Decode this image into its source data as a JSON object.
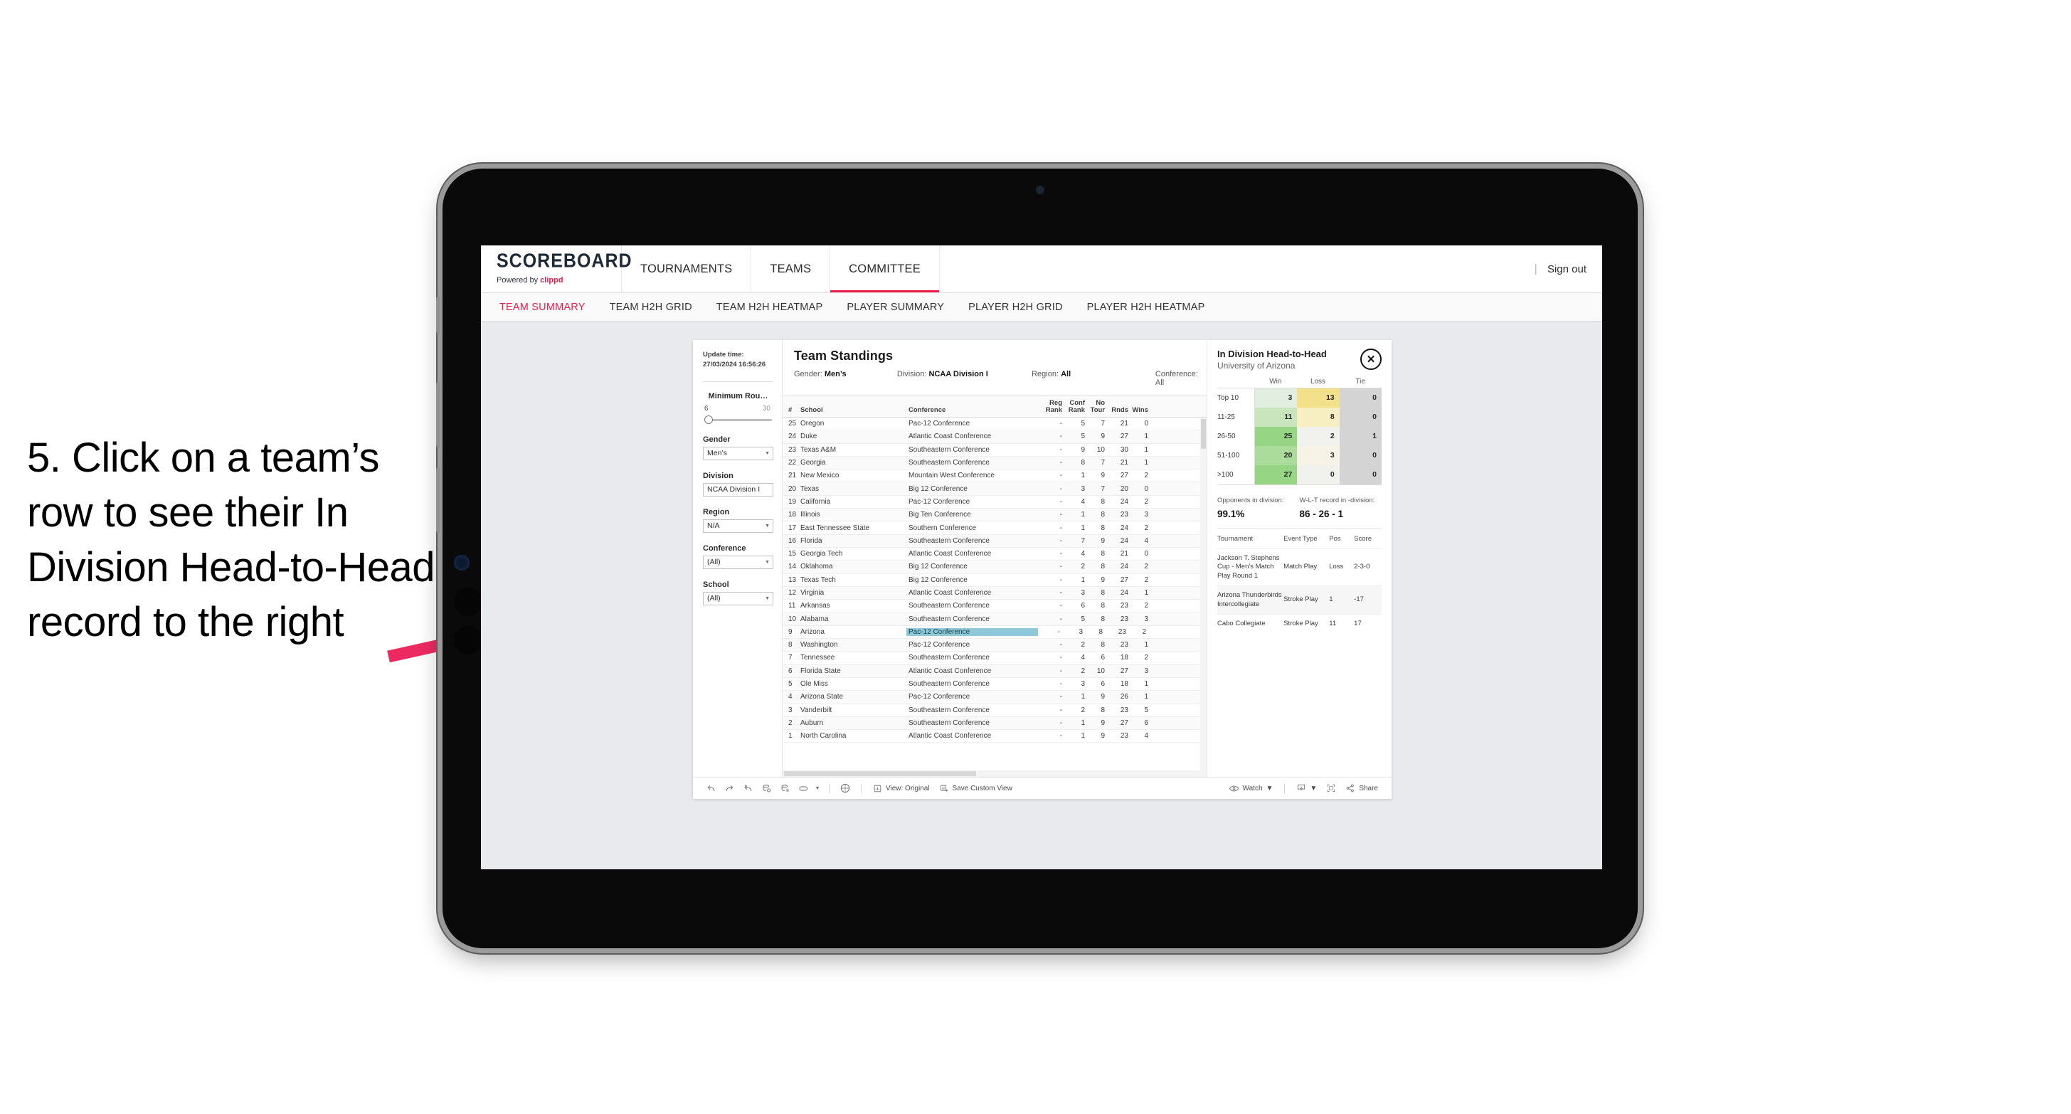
{
  "annotation": {
    "text": "5. Click on a team’s row to see their In Division Head-to-Head record to the right",
    "arrow_color": "#ec2a61"
  },
  "app": {
    "brand": {
      "name": "SCOREBOARD",
      "powered_prefix": "Powered by ",
      "powered_brand": "clippd"
    },
    "nav": [
      {
        "label": "TOURNAMENTS",
        "active": false
      },
      {
        "label": "TEAMS",
        "active": false
      },
      {
        "label": "COMMITTEE",
        "active": true
      }
    ],
    "sign_out": "Sign out",
    "divider": "|",
    "subnav": [
      {
        "label": "TEAM SUMMARY",
        "active": true
      },
      {
        "label": "TEAM H2H GRID",
        "active": false
      },
      {
        "label": "TEAM H2H HEATMAP",
        "active": false
      },
      {
        "label": "PLAYER SUMMARY",
        "active": false
      },
      {
        "label": "PLAYER H2H GRID",
        "active": false
      },
      {
        "label": "PLAYER H2H HEATMAP",
        "active": false
      }
    ]
  },
  "filters": {
    "update_time_label": "Update time:",
    "update_time_value": "27/03/2024 16:56:26",
    "slider": {
      "label": "Minimum Rou…",
      "min": "6",
      "max": "30"
    },
    "groups": [
      {
        "label": "Gender",
        "value": "Men’s"
      },
      {
        "label": "Division",
        "value": "NCAA Division I"
      },
      {
        "label": "Region",
        "value": "N/A"
      },
      {
        "label": "Conference",
        "value": "(All)"
      },
      {
        "label": "School",
        "value": "(All)"
      }
    ]
  },
  "standings": {
    "title": "Team Standings",
    "criteria": [
      {
        "label": "Gender:",
        "value": "Men’s"
      },
      {
        "label": "Division:",
        "value": "NCAA Division I"
      },
      {
        "label": "Region:",
        "value": "All"
      },
      {
        "label": "Conference:",
        "value": "All"
      }
    ],
    "columns": [
      "#",
      "School",
      "Conference",
      "Reg Rank",
      "Conf Rank",
      "No Tour",
      "Rnds",
      "Wins"
    ],
    "rows": [
      {
        "n": "1",
        "school": "North Carolina",
        "conf": "Atlantic Coast Conference",
        "reg": "-",
        "cr": "1",
        "nt": "9",
        "rnds": "23",
        "wins": "4",
        "selected": false
      },
      {
        "n": "2",
        "school": "Auburn",
        "conf": "Southeastern Conference",
        "reg": "-",
        "cr": "1",
        "nt": "9",
        "rnds": "27",
        "wins": "6",
        "selected": false
      },
      {
        "n": "3",
        "school": "Vanderbilt",
        "conf": "Southeastern Conference",
        "reg": "-",
        "cr": "2",
        "nt": "8",
        "rnds": "23",
        "wins": "5",
        "selected": false
      },
      {
        "n": "4",
        "school": "Arizona State",
        "conf": "Pac-12 Conference",
        "reg": "-",
        "cr": "1",
        "nt": "9",
        "rnds": "26",
        "wins": "1",
        "selected": false
      },
      {
        "n": "5",
        "school": "Ole Miss",
        "conf": "Southeastern Conference",
        "reg": "-",
        "cr": "3",
        "nt": "6",
        "rnds": "18",
        "wins": "1",
        "selected": false
      },
      {
        "n": "6",
        "school": "Florida State",
        "conf": "Atlantic Coast Conference",
        "reg": "-",
        "cr": "2",
        "nt": "10",
        "rnds": "27",
        "wins": "3",
        "selected": false
      },
      {
        "n": "7",
        "school": "Tennessee",
        "conf": "Southeastern Conference",
        "reg": "-",
        "cr": "4",
        "nt": "6",
        "rnds": "18",
        "wins": "2",
        "selected": false
      },
      {
        "n": "8",
        "school": "Washington",
        "conf": "Pac-12 Conference",
        "reg": "-",
        "cr": "2",
        "nt": "8",
        "rnds": "23",
        "wins": "1",
        "selected": false
      },
      {
        "n": "9",
        "school": "Arizona",
        "conf": "Pac-12 Conference",
        "reg": "-",
        "cr": "3",
        "nt": "8",
        "rnds": "23",
        "wins": "2",
        "selected": true
      },
      {
        "n": "10",
        "school": "Alabama",
        "conf": "Southeastern Conference",
        "reg": "-",
        "cr": "5",
        "nt": "8",
        "rnds": "23",
        "wins": "3",
        "selected": false
      },
      {
        "n": "11",
        "school": "Arkansas",
        "conf": "Southeastern Conference",
        "reg": "-",
        "cr": "6",
        "nt": "8",
        "rnds": "23",
        "wins": "2",
        "selected": false
      },
      {
        "n": "12",
        "school": "Virginia",
        "conf": "Atlantic Coast Conference",
        "reg": "-",
        "cr": "3",
        "nt": "8",
        "rnds": "24",
        "wins": "1",
        "selected": false
      },
      {
        "n": "13",
        "school": "Texas Tech",
        "conf": "Big 12 Conference",
        "reg": "-",
        "cr": "1",
        "nt": "9",
        "rnds": "27",
        "wins": "2",
        "selected": false
      },
      {
        "n": "14",
        "school": "Oklahoma",
        "conf": "Big 12 Conference",
        "reg": "-",
        "cr": "2",
        "nt": "8",
        "rnds": "24",
        "wins": "2",
        "selected": false
      },
      {
        "n": "15",
        "school": "Georgia Tech",
        "conf": "Atlantic Coast Conference",
        "reg": "-",
        "cr": "4",
        "nt": "8",
        "rnds": "21",
        "wins": "0",
        "selected": false
      },
      {
        "n": "16",
        "school": "Florida",
        "conf": "Southeastern Conference",
        "reg": "-",
        "cr": "7",
        "nt": "9",
        "rnds": "24",
        "wins": "4",
        "selected": false
      },
      {
        "n": "17",
        "school": "East Tennessee State",
        "conf": "Southern Conference",
        "reg": "-",
        "cr": "1",
        "nt": "8",
        "rnds": "24",
        "wins": "2",
        "selected": false
      },
      {
        "n": "18",
        "school": "Illinois",
        "conf": "Big Ten Conference",
        "reg": "-",
        "cr": "1",
        "nt": "8",
        "rnds": "23",
        "wins": "3",
        "selected": false
      },
      {
        "n": "19",
        "school": "California",
        "conf": "Pac-12 Conference",
        "reg": "-",
        "cr": "4",
        "nt": "8",
        "rnds": "24",
        "wins": "2",
        "selected": false
      },
      {
        "n": "20",
        "school": "Texas",
        "conf": "Big 12 Conference",
        "reg": "-",
        "cr": "3",
        "nt": "7",
        "rnds": "20",
        "wins": "0",
        "selected": false
      },
      {
        "n": "21",
        "school": "New Mexico",
        "conf": "Mountain West Conference",
        "reg": "-",
        "cr": "1",
        "nt": "9",
        "rnds": "27",
        "wins": "2",
        "selected": false
      },
      {
        "n": "22",
        "school": "Georgia",
        "conf": "Southeastern Conference",
        "reg": "-",
        "cr": "8",
        "nt": "7",
        "rnds": "21",
        "wins": "1",
        "selected": false
      },
      {
        "n": "23",
        "school": "Texas A&M",
        "conf": "Southeastern Conference",
        "reg": "-",
        "cr": "9",
        "nt": "10",
        "rnds": "30",
        "wins": "1",
        "selected": false
      },
      {
        "n": "24",
        "school": "Duke",
        "conf": "Atlantic Coast Conference",
        "reg": "-",
        "cr": "5",
        "nt": "9",
        "rnds": "27",
        "wins": "1",
        "selected": false
      },
      {
        "n": "25",
        "school": "Oregon",
        "conf": "Pac-12 Conference",
        "reg": "-",
        "cr": "5",
        "nt": "7",
        "rnds": "21",
        "wins": "0",
        "selected": false
      }
    ]
  },
  "h2h": {
    "title": "In Division Head-to-Head",
    "subtitle": "University of Arizona",
    "close_icon": "close-icon",
    "matrix_columns": [
      "Win",
      "Loss",
      "Tie"
    ],
    "matrix_rows": [
      {
        "band": "Top 10",
        "win": "3",
        "loss": "13",
        "tie": "0",
        "win_color": "#e2efe0",
        "loss_color": "#f2e08a",
        "tie_color": "#d4d4d4"
      },
      {
        "band": "11-25",
        "win": "11",
        "loss": "8",
        "tie": "0",
        "win_color": "#c8e5bd",
        "loss_color": "#f7eec2",
        "tie_color": "#d4d4d4"
      },
      {
        "band": "26-50",
        "win": "25",
        "loss": "2",
        "tie": "1",
        "win_color": "#96d584",
        "loss_color": "#f1f1ee",
        "tie_color": "#d4d4d4"
      },
      {
        "band": "51-100",
        "win": "20",
        "loss": "3",
        "tie": "0",
        "win_color": "#abdc9b",
        "loss_color": "#f6f2e6",
        "tie_color": "#d4d4d4"
      },
      {
        "band": ">100",
        "win": "27",
        "loss": "0",
        "tie": "0",
        "win_color": "#96d584",
        "loss_color": "#f1f1ee",
        "tie_color": "#d4d4d4"
      }
    ],
    "stats": [
      {
        "label": "Opponents in division:",
        "value": "99.1%"
      },
      {
        "label": "W-L-T record in -division:",
        "value": "86 - 26 - 1"
      }
    ],
    "tournament_columns": [
      "Tournament",
      "Event Type",
      "Pos",
      "Score"
    ],
    "tournaments": [
      {
        "name": "Jackson T. Stephens Cup - Men’s Match Play Round 1",
        "type": "Match Play",
        "pos": "Loss",
        "score": "2-3-0"
      },
      {
        "name": "Arizona Thunderbirds Intercollegiate",
        "type": "Stroke Play",
        "pos": "1",
        "score": "-17"
      },
      {
        "name": "Cabo Collegiate",
        "type": "Stroke Play",
        "pos": "11",
        "score": "17"
      }
    ]
  },
  "toolbar": {
    "icons": [
      "undo-icon",
      "redo-icon",
      "revert-icon",
      "refresh-data-icon",
      "pause-updates-icon",
      "highlight-icon",
      "dropdown-caret-icon",
      "dashboard-icon"
    ],
    "view_label": "View: Original",
    "save_label": "Save Custom View",
    "watch_label": "Watch",
    "share_label": "Share",
    "download_icon": "download-icon",
    "fullscreen_icon": "fullscreen-icon",
    "eye_icon": "eye-icon",
    "share_icon": "share-icon",
    "view_icon": "view-original-icon",
    "save_icon": "save-view-icon"
  }
}
